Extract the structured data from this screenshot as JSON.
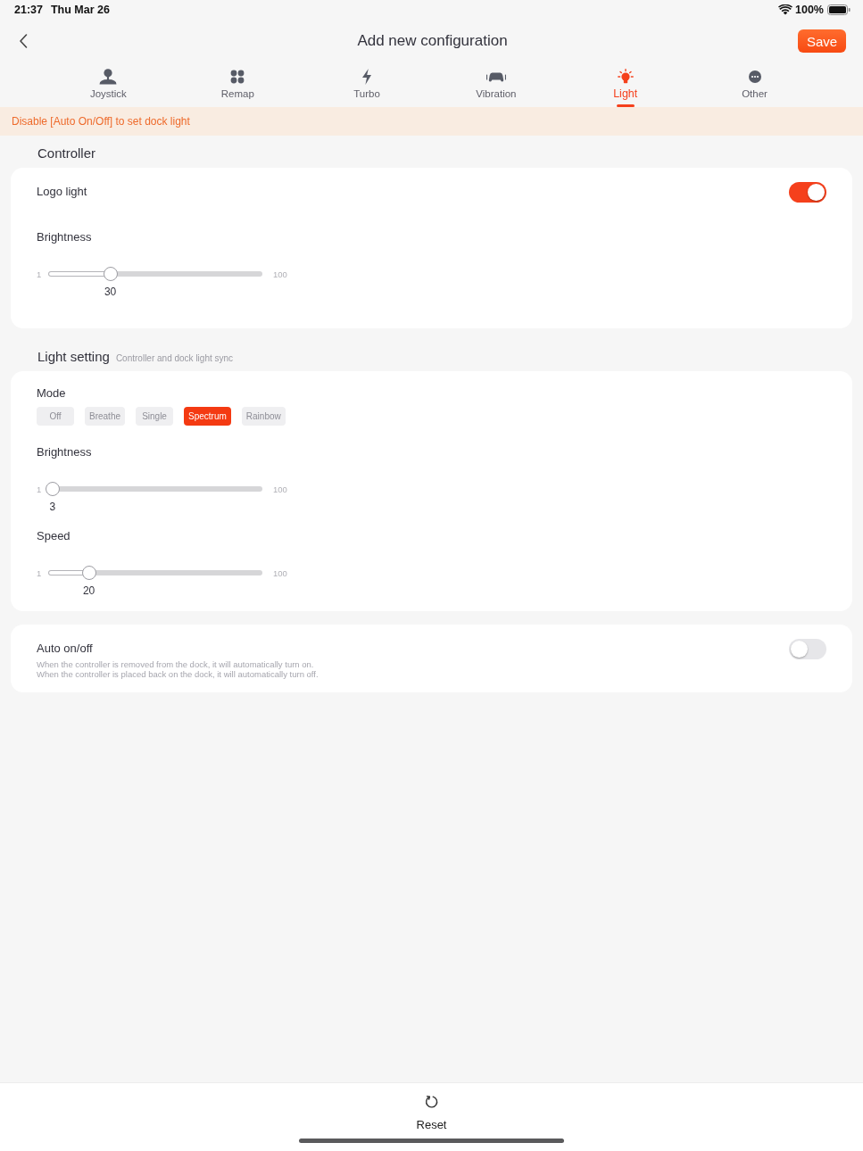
{
  "status_bar": {
    "time": "21:37",
    "date": "Thu Mar 26",
    "battery": "100%"
  },
  "nav_bar": {
    "title": "Add new configuration",
    "save_button": "Save"
  },
  "tabs": [
    {
      "label": "Joystick",
      "kind": "joystick",
      "selected": false
    },
    {
      "label": "Remap",
      "kind": "remap",
      "selected": false
    },
    {
      "label": "Turbo",
      "kind": "turbo",
      "selected": false
    },
    {
      "label": "Vibration",
      "kind": "vibration",
      "selected": false
    },
    {
      "label": "Light",
      "kind": "light",
      "selected": true
    },
    {
      "label": "Other",
      "kind": "other",
      "selected": false
    }
  ],
  "notice": "Disable [Auto On/Off] to set dock light",
  "sections": [
    {
      "title": "Controller",
      "rows": [
        {
          "kind": "toggle",
          "label": "Logo light",
          "on": true
        },
        {
          "kind": "slider",
          "label": "Brightness",
          "min": "1",
          "max": "100",
          "reading": "30",
          "level": 0.29
        }
      ]
    },
    {
      "title": "Light setting",
      "subtitle": "Controller and dock light sync",
      "rows": [
        {
          "kind": "choice",
          "label": "Mode",
          "options": [
            {
              "label": "Off",
              "selected": false
            },
            {
              "label": "Breathe",
              "selected": false
            },
            {
              "label": "Single",
              "selected": false
            },
            {
              "label": "Spectrum",
              "selected": true
            },
            {
              "label": "Rainbow",
              "selected": false
            }
          ]
        },
        {
          "kind": "slider",
          "label": "Brightness",
          "min": "1",
          "max": "100",
          "reading": "3",
          "level": 0.02
        },
        {
          "kind": "slider",
          "label": "Speed",
          "min": "1",
          "max": "100",
          "reading": "20",
          "level": 0.19
        }
      ]
    },
    {
      "rows": [
        {
          "kind": "toggle",
          "label": "Auto on/off",
          "description": "When the controller is removed from the dock, it will automatically turn on.\nWhen the controller is placed back on the dock, it will automatically turn off.",
          "on": false
        }
      ]
    }
  ],
  "footer": {
    "reset_button": "Reset"
  }
}
